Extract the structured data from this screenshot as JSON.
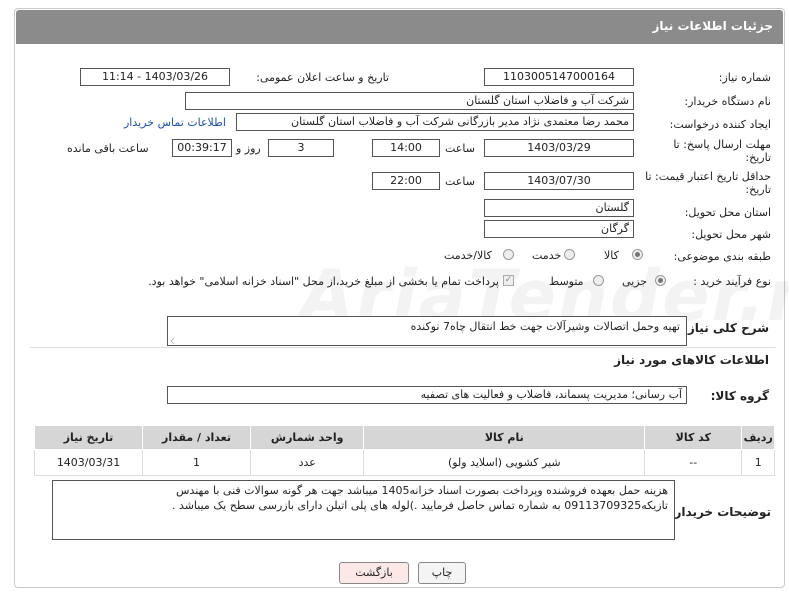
{
  "header": {
    "title": "جزئیات اطلاعات نیاز"
  },
  "fields": {
    "need_number_label": "شماره نیاز:",
    "need_number_value": "1103005147000164",
    "announce_label": "تاریخ و ساعت اعلان عمومی:",
    "announce_value": "1403/03/26 - 11:14",
    "buyer_org_label": "نام دستگاه خریدار:",
    "buyer_org_value": "شرکت آب و فاضلاب استان گلستان",
    "requester_label": "ایجاد کننده درخواست:",
    "requester_value": "محمد رضا معتمدی نژاد مدیر بازرگانی شرکت آب و فاضلاب استان گلستان",
    "buyer_contact_link": "اطلاعات تماس خریدار",
    "reply_deadline_label_1": "مهلت ارسال پاسخ: تا",
    "reply_deadline_label_2": "تاریخ:",
    "reply_date": "1403/03/29",
    "time_label": "ساعت",
    "reply_time": "14:00",
    "days_value": "3",
    "days_label": "روز و",
    "remaining_value": "00:39:17",
    "remaining_label": "ساعت باقی مانده",
    "price_validity_label_1": "حداقل تاریخ اعتبار قیمت: تا",
    "price_validity_label_2": "تاریخ:",
    "price_date": "1403/07/30",
    "price_time": "22:00",
    "province_label": "استان محل تحویل:",
    "province_value": "گلستان",
    "city_label": "شهر محل تحویل:",
    "city_value": "گرگان",
    "category_label": "طبقه بندی موضوعی:",
    "category_options": [
      "کالا",
      "خدمت",
      "کالا/خدمت"
    ],
    "process_label": "نوع فرآیند خرید :",
    "process_options": [
      "جزیی",
      "متوسط"
    ],
    "payment_note": "پرداخت تمام یا بخشی از مبلغ خرید،از محل \"اسناد خزانه اسلامی\" خواهد بود."
  },
  "description": {
    "label": "شرح کلی نیاز:",
    "value": "تهیه وحمل اتصالات وشیرآلات جهت خط انتقال چاه7 نوکنده"
  },
  "goods_section": {
    "title": "اطلاعات کالاهای مورد نیاز",
    "group_label": "گروه کالا:",
    "group_value": "آب رسانی؛ مدیریت پسماند، فاضلاب و فعالیت های تصفیه"
  },
  "table": {
    "headers": [
      "ردیف",
      "کد کالا",
      "نام کالا",
      "واحد شمارش",
      "تعداد / مقدار",
      "تاریخ نیاز"
    ],
    "rows": [
      [
        "1",
        "--",
        "شیر کشویی (اسلاید ولو)",
        "عدد",
        "1",
        "1403/03/31"
      ]
    ]
  },
  "buyer_notes": {
    "label": "توضیحات خریدار:",
    "line1": "هزینه حمل بعهده فروشنده وپرداخت بصورت اسناد خزانه1405 میباشد جهت هر گونه سوالات فنی با مهندس",
    "line2": "تازیکه09113709325 به شماره  تماس حاصل فرمایید .)لوله های پلی اتیلن دارای بازرسی سطح یک میباشد ."
  },
  "buttons": {
    "print": "چاپ",
    "back": "بازگشت"
  },
  "watermark": "AriaTender.net",
  "colors": {
    "header_bg": "#8b8b8b",
    "link": "#1a4fb5",
    "back_button_bg": "#fde8e8",
    "table_header_bg": "#d6d6d6"
  }
}
